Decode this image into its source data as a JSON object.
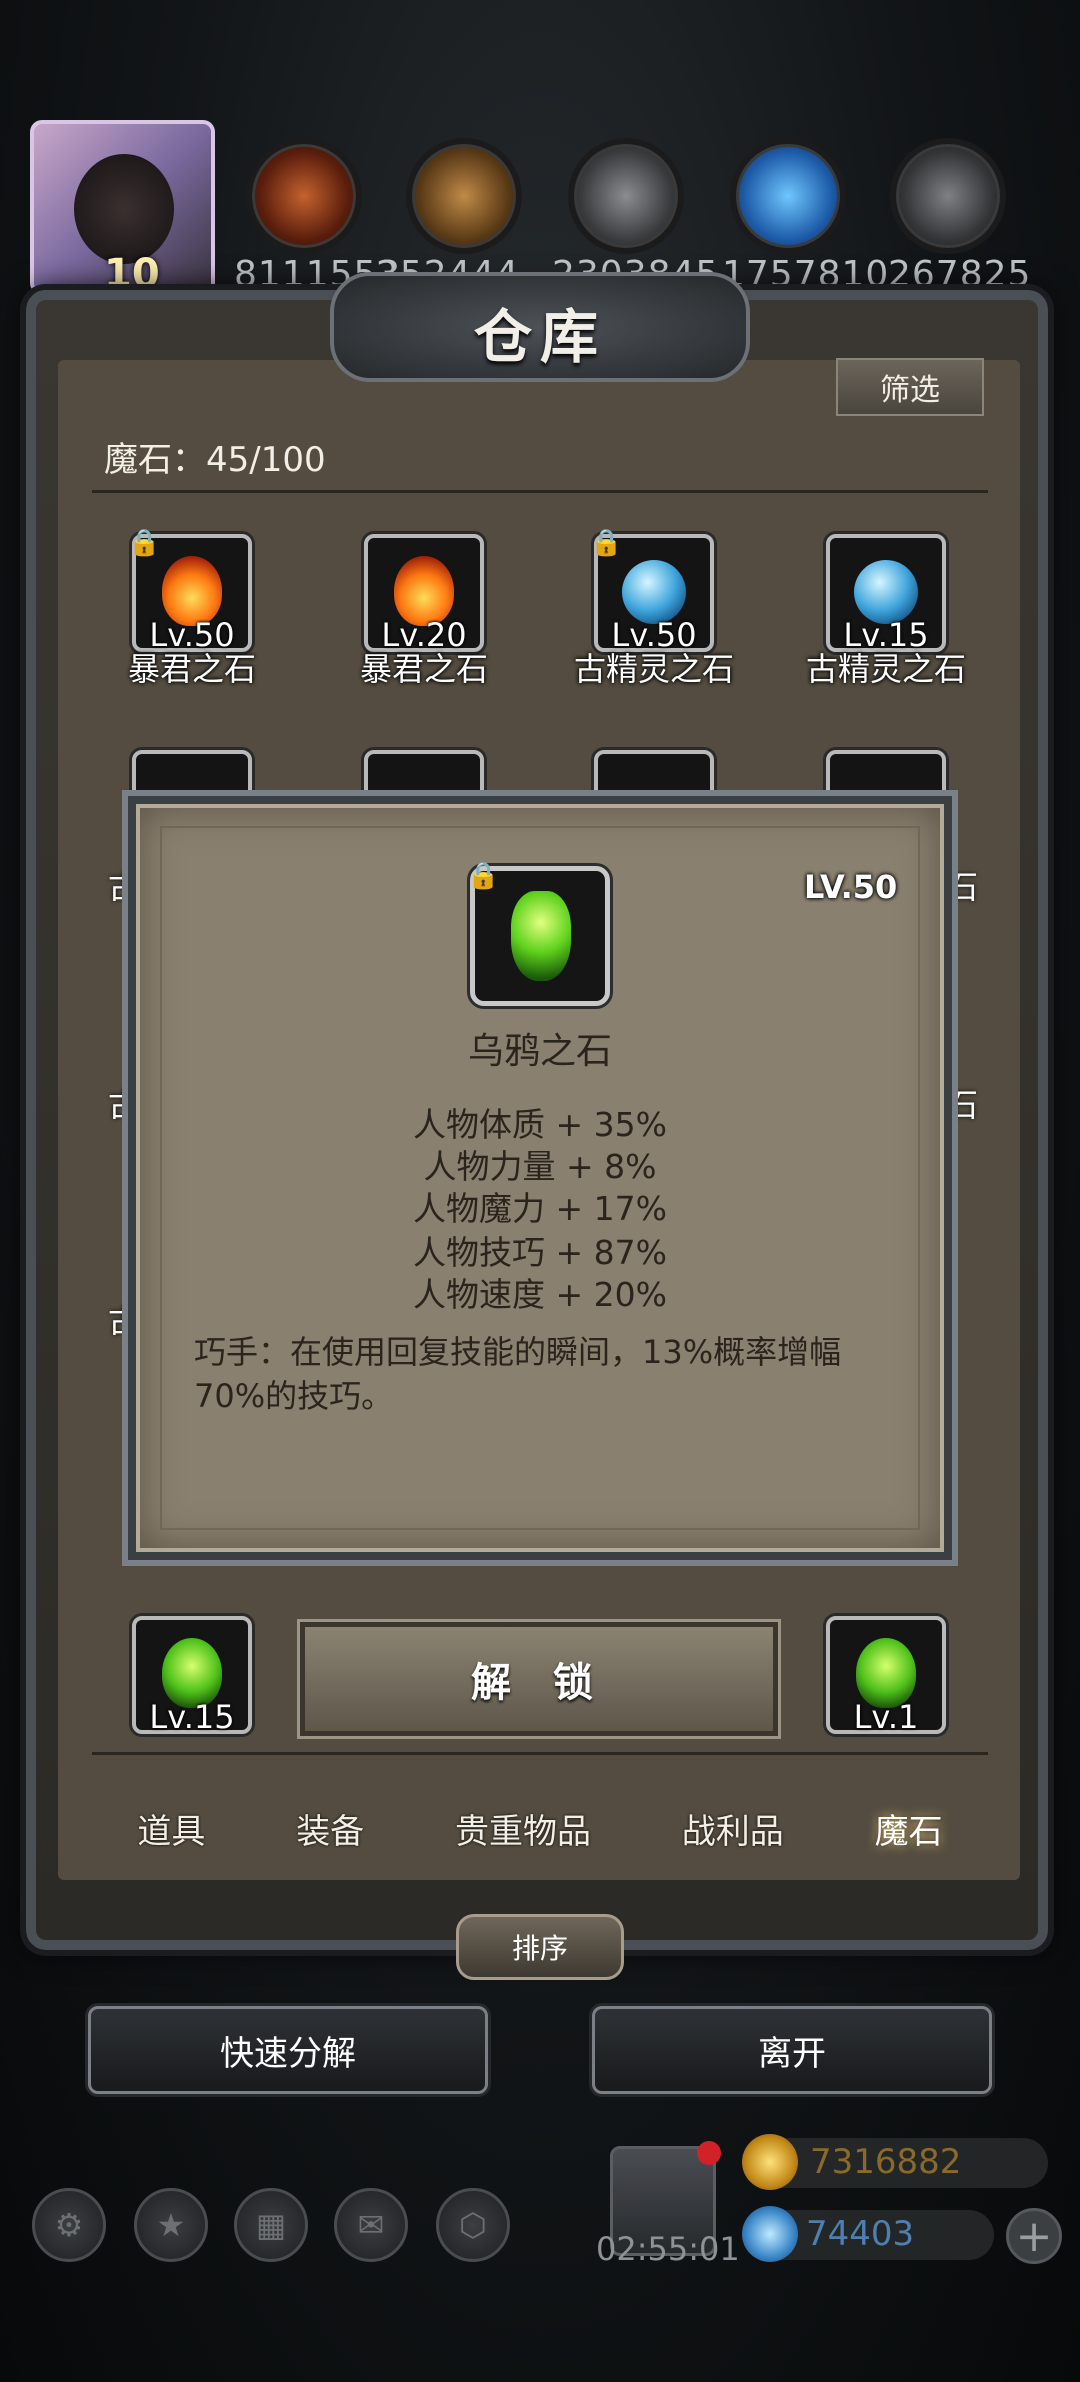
{
  "top_bar": {
    "avatar_level": "10",
    "resources": [
      {
        "icon": "meat-icon",
        "count": "8111553"
      },
      {
        "icon": "wood-planks-icon",
        "count": "252444"
      },
      {
        "icon": "iron-ingot-icon",
        "count": "2303845"
      },
      {
        "icon": "blue-crystal-icon",
        "count": "1757810"
      },
      {
        "icon": "stone-block-icon",
        "count": "267825"
      }
    ]
  },
  "warehouse": {
    "title": "仓库",
    "filter_label": "筛选",
    "capacity_label": "魔石：45/100"
  },
  "grid": {
    "row1": [
      {
        "name": "暴君之石",
        "level": "Lv.50",
        "gem": "fire",
        "locked": true
      },
      {
        "name": "暴君之石",
        "level": "Lv.20",
        "gem": "fire",
        "locked": false
      },
      {
        "name": "古精灵之石",
        "level": "Lv.50",
        "gem": "ice",
        "locked": true
      },
      {
        "name": "古精灵之石",
        "level": "Lv.15",
        "gem": "ice",
        "locked": false
      }
    ],
    "side_names": {
      "left1": "古",
      "left2": "古",
      "left3": "古",
      "right1": "石",
      "right2": "石"
    },
    "bottom_row": [
      {
        "level": "Lv.15",
        "gem": "green"
      },
      {
        "level": "Lv.1",
        "gem": "green"
      }
    ]
  },
  "popup": {
    "level": "LV.50",
    "name": "乌鸦之石",
    "stats": [
      "人物体质 + 35%",
      "人物力量 + 8%",
      "人物魔力 + 17%",
      "人物技巧 + 87%",
      "人物速度 + 20%"
    ],
    "skill_text": "巧手：在使用回复技能的瞬间，13%概率增幅70%的技巧。",
    "unlock_label": "解 锁"
  },
  "tabs": [
    {
      "label": "道具",
      "active": false
    },
    {
      "label": "装备",
      "active": false
    },
    {
      "label": "贵重物品",
      "active": false
    },
    {
      "label": "战利品",
      "active": false
    },
    {
      "label": "魔石",
      "active": true
    }
  ],
  "sort_label": "排序",
  "actions": {
    "quick_decompose": "快速分解",
    "leave": "离开"
  },
  "bottom_bar": {
    "timer": "02:55:01",
    "gold": "7316882",
    "diamonds": "74403",
    "plus_label": "+"
  },
  "colors": {
    "panel": "#544c40",
    "popup": "#8a8070",
    "gold_text": "#8a6a2a",
    "diamond_text": "#4f7fb0"
  }
}
